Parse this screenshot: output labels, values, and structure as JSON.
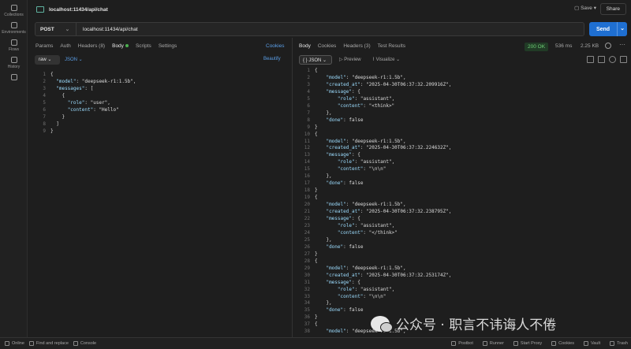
{
  "rail": {
    "items": [
      {
        "label": "Collections",
        "icon": "trash-icon"
      },
      {
        "label": "Environments",
        "icon": "environment-icon"
      },
      {
        "label": "Flows",
        "icon": "flows-icon"
      },
      {
        "label": "History",
        "icon": "history-icon"
      },
      {
        "label": "",
        "icon": "add-tools-icon"
      }
    ]
  },
  "header": {
    "title": "localhost:11434/api/chat",
    "save_label": "Save",
    "share_label": "Share"
  },
  "request": {
    "method": "POST",
    "url": "localhost:11434/api/chat",
    "send_label": "Send",
    "tabs": [
      "Params",
      "Auth",
      "Headers (8)",
      "Body",
      "Scripts",
      "Settings"
    ],
    "cookies_label": "Cookies",
    "body_mode": "raw",
    "body_format": "JSON",
    "beautify_label": "Beautify",
    "code_lines": [
      "{",
      "  \"model\": \"deepseek-r1:1.5b\",",
      "  \"messages\": [",
      "    {",
      "      \"role\": \"user\",",
      "      \"content\": \"Hello\"",
      "    }",
      "  ]",
      "}"
    ]
  },
  "response": {
    "tabs": [
      "Body",
      "Cookies",
      "Headers (3)",
      "Test Results"
    ],
    "status": "200 OK",
    "time": "536 ms",
    "size": "2.25 KB",
    "format": "JSON",
    "preview_label": "Preview",
    "visualize_label": "Visualize",
    "code_lines": [
      "{",
      "    \"model\": \"deepseek-r1:1.5b\",",
      "    \"created_at\": \"2025-04-30T06:37:32.209916Z\",",
      "    \"message\": {",
      "        \"role\": \"assistant\",",
      "        \"content\": \"<think>\"",
      "    },",
      "    \"done\": false",
      "}",
      "{",
      "    \"model\": \"deepseek-r1:1.5b\",",
      "    \"created_at\": \"2025-04-30T06:37:32.224632Z\",",
      "    \"message\": {",
      "        \"role\": \"assistant\",",
      "        \"content\": \"\\n\\n\"",
      "    },",
      "    \"done\": false",
      "}",
      "{",
      "    \"model\": \"deepseek-r1:1.5b\",",
      "    \"created_at\": \"2025-04-30T06:37:32.238795Z\",",
      "    \"message\": {",
      "        \"role\": \"assistant\",",
      "        \"content\": \"</think>\"",
      "    },",
      "    \"done\": false",
      "}",
      "{",
      "    \"model\": \"deepseek-r1:1.5b\",",
      "    \"created_at\": \"2025-04-30T06:37:32.253174Z\",",
      "    \"message\": {",
      "        \"role\": \"assistant\",",
      "        \"content\": \"\\n\\n\"",
      "    },",
      "    \"done\": false",
      "}",
      "{",
      "    \"model\": \"deepseek-r1:1.5b\","
    ]
  },
  "watermark": {
    "text": "公众号 · 职言不讳诲人不倦"
  },
  "statusbar": {
    "left": [
      "Online",
      "Find and replace",
      "Console"
    ],
    "right": [
      "Postbot",
      "Runner",
      "Start Proxy",
      "Cookies",
      "Vault",
      "Trash"
    ]
  },
  "colors": {
    "accent": "#1f6fd1",
    "status_ok": "#6fcf76",
    "link": "#5b9fe8",
    "background": "#1e1e1e"
  }
}
